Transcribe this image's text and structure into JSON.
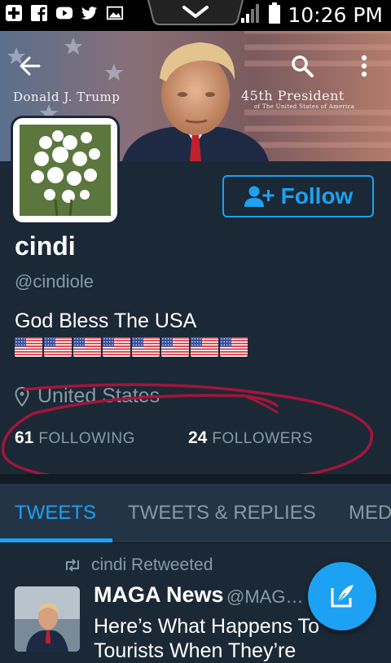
{
  "status_bar": {
    "time": "10:26 PM",
    "icons": [
      "add-icon",
      "facebook-icon",
      "youtube-icon",
      "twitter-icon",
      "image-icon",
      "signal-icon",
      "battery-icon"
    ]
  },
  "header": {
    "banner_left": "Donald J. Trump",
    "banner_right_main": "45th President",
    "banner_right_sub": "of The United States of America",
    "back_icon": "arrow-left-icon",
    "search_icon": "search-icon",
    "menu_icon": "more-vertical-icon"
  },
  "profile": {
    "name": "cindi",
    "handle": "@cindiole",
    "bio": "God Bless The USA",
    "flag_count": 8,
    "location": "United States",
    "follow_label": "Follow",
    "following_count": "61",
    "following_label": "FOLLOWING",
    "followers_count": "24",
    "followers_label": "FOLLOWERS"
  },
  "tabs": [
    {
      "label": "TWEETS",
      "active": true
    },
    {
      "label": "TWEETS & REPLIES",
      "active": false
    },
    {
      "label": "MED",
      "active": false
    }
  ],
  "tweet": {
    "retweet_label": "cindi Retweeted",
    "author": "MAGA News",
    "author_handle": "@MAG…",
    "text": "Here’s What Happens To Tourists When They’re"
  },
  "colors": {
    "accent": "#1da1f2",
    "background": "#1b2836",
    "muted": "#8899a6",
    "annotation": "#a1163a"
  }
}
